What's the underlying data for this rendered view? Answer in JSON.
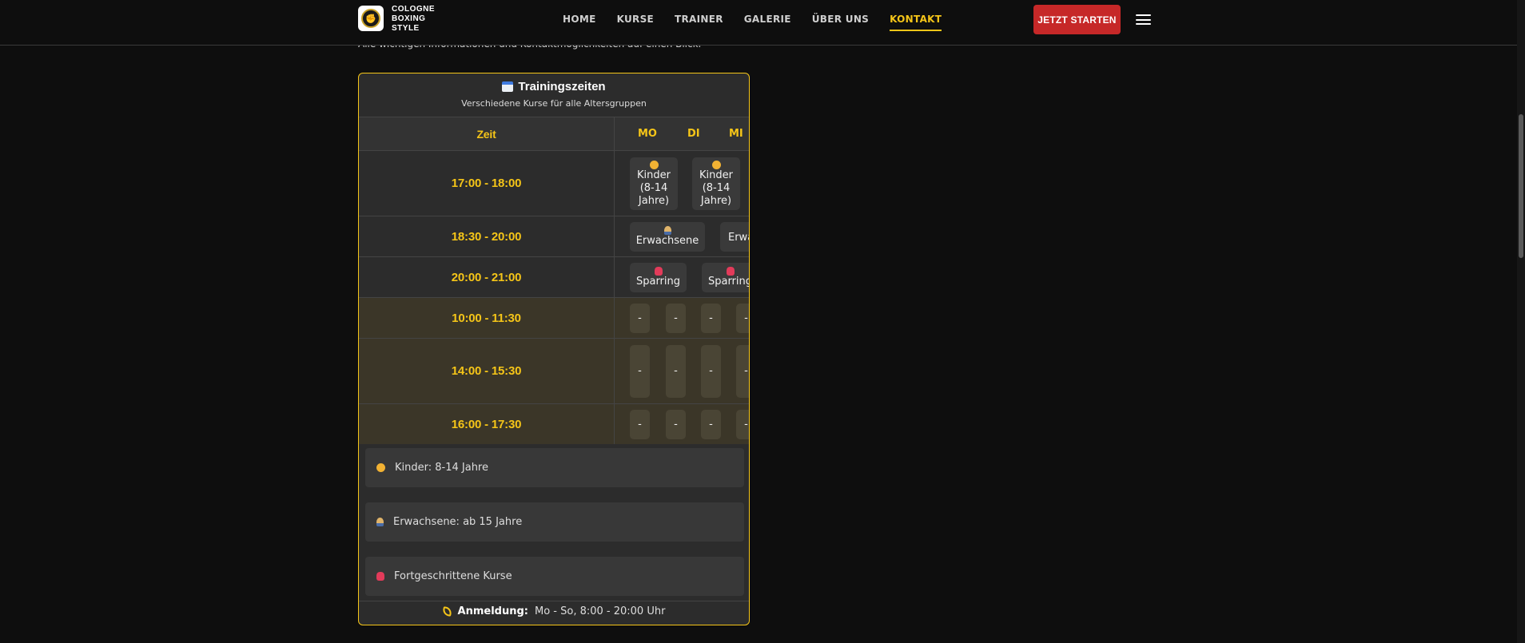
{
  "brand": {
    "line1": "COLOGNE",
    "line2": "BOXING",
    "line3": "STYLE"
  },
  "nav": {
    "items": [
      {
        "label": "HOME"
      },
      {
        "label": "KURSE"
      },
      {
        "label": "TRAINER"
      },
      {
        "label": "GALERIE"
      },
      {
        "label": "ÜBER UNS"
      },
      {
        "label": "KONTAKT",
        "active": true
      }
    ],
    "cta": "JETZT STARTEN"
  },
  "intro_text": "Alle wichtigen Informationen und Kontaktmöglichkeiten auf einen Blick.",
  "schedule": {
    "title": "Trainingszeiten",
    "subtitle": "Verschiedene Kurse für alle Altersgruppen",
    "time_header": "Zeit",
    "days": [
      "MO",
      "DI",
      "MI"
    ],
    "rows": [
      {
        "time": "17:00 - 18:00",
        "slot_a": "Kinder (8-14 Jahre)",
        "slot_b": "Kinder (8-14 Jahre)"
      },
      {
        "time": "18:30 - 20:00",
        "slot_a": "Erwachsene",
        "slot_b": "Erwa"
      },
      {
        "time": "20:00 - 21:00",
        "slot_a": "Sparring",
        "slot_b": "Sparring"
      },
      {
        "time": "10:00 - 11:30",
        "dash": "-"
      },
      {
        "time": "14:00 - 15:30",
        "dash": "-"
      },
      {
        "time": "16:00 - 17:30",
        "dash": "-"
      }
    ],
    "legend": [
      {
        "icon": "kid-face-icon",
        "text": "Kinder: 8-14 Jahre"
      },
      {
        "icon": "adult-person-icon",
        "text": "Erwachsene: ab 15 Jahre"
      },
      {
        "icon": "boxing-glove-icon",
        "text": "Fortgeschrittene Kurse"
      }
    ],
    "registration": {
      "label": "Anmeldung:",
      "value": "Mo - So, 8:00 - 20:00 Uhr"
    }
  },
  "colors": {
    "accent": "#f5c518",
    "cta": "#c62828",
    "background": "#0e0e0e",
    "card": "#2c2c2c"
  }
}
